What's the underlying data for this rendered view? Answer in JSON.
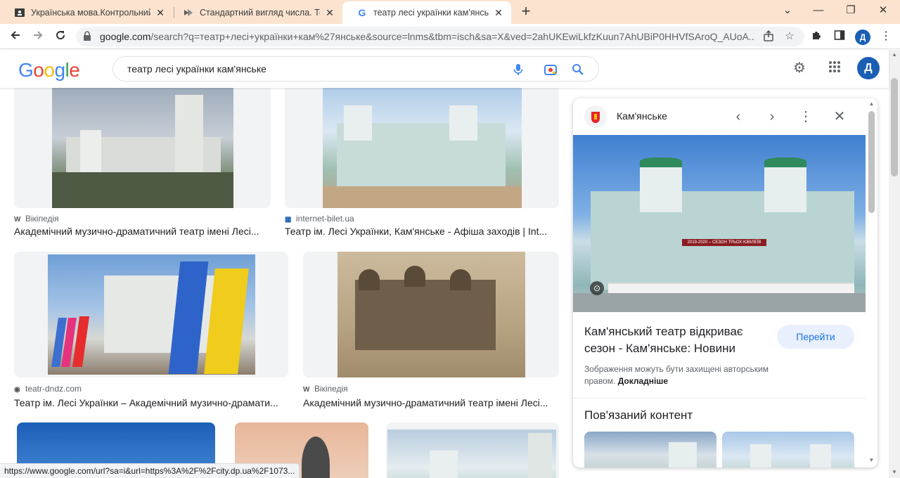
{
  "tabs": [
    {
      "title": "Українська мова.Контрольний п",
      "favicon": "classroom-icon",
      "active": false
    },
    {
      "title": "Стандартний вигляд числа. Тест",
      "favicon": "vseosvita-icon",
      "active": false
    },
    {
      "title": "театр лесі українки кам'янське -",
      "favicon": "google-icon",
      "active": true
    }
  ],
  "window": {
    "minimize": "⌄",
    "min": "—",
    "restore": "❐",
    "close": "✕",
    "new_tab": "+"
  },
  "address": {
    "host": "google.com",
    "path": "/search?q=театр+лесі+українки+кам%27янське&source=lnms&tbm=isch&sa=X&ved=2ahUKEwiLkfzKuun7AhUBiP0HHVfSAroQ_AUoA..."
  },
  "profile_letter": "Д",
  "google": {
    "logo": [
      "G",
      "o",
      "o",
      "g",
      "l",
      "e"
    ],
    "logo_colors": [
      "#4285F4",
      "#EA4335",
      "#FBBC05",
      "#4285F4",
      "#34A853",
      "#EA4335"
    ],
    "query": "театр лесі українки кам'янське",
    "avatar_letter": "Д"
  },
  "results": [
    {
      "source": "Вікіпедія",
      "source_icon": "W",
      "title": "Академічний музично-драматичний театр імені Лесі..."
    },
    {
      "source": "internet-bilet.ua",
      "source_icon": "▦",
      "title": "Театр ім. Лесі Українки, Кам'янське - Афіша заходів | Int..."
    },
    {
      "source": "teatr-dndz.com",
      "source_icon": "◉",
      "title": "Театр ім. Лесі Українки – Академічний музично-драмати..."
    },
    {
      "source": "Вікіпедія",
      "source_icon": "W",
      "title": "Академічний музично-драматичний театр імені Лесі..."
    }
  ],
  "panel": {
    "site_name": "Кам'янське",
    "title": "Кам'янський театр відкриває сезон - Кам'янське: Новини",
    "go_button": "Перейти",
    "note": "Зображення можуть бути захищені авторським правом.",
    "note_link": "Докладніше",
    "related_heading": "Пов'язаний контент",
    "banner_text": "2019-2020 – СЕЗОН ТРЬОХ ЮВІЛЕЇВ"
  },
  "status_url": "https://www.google.com/url?sa=i&url=https%3A%2F%2Fcity.dp.ua%2F1073..."
}
